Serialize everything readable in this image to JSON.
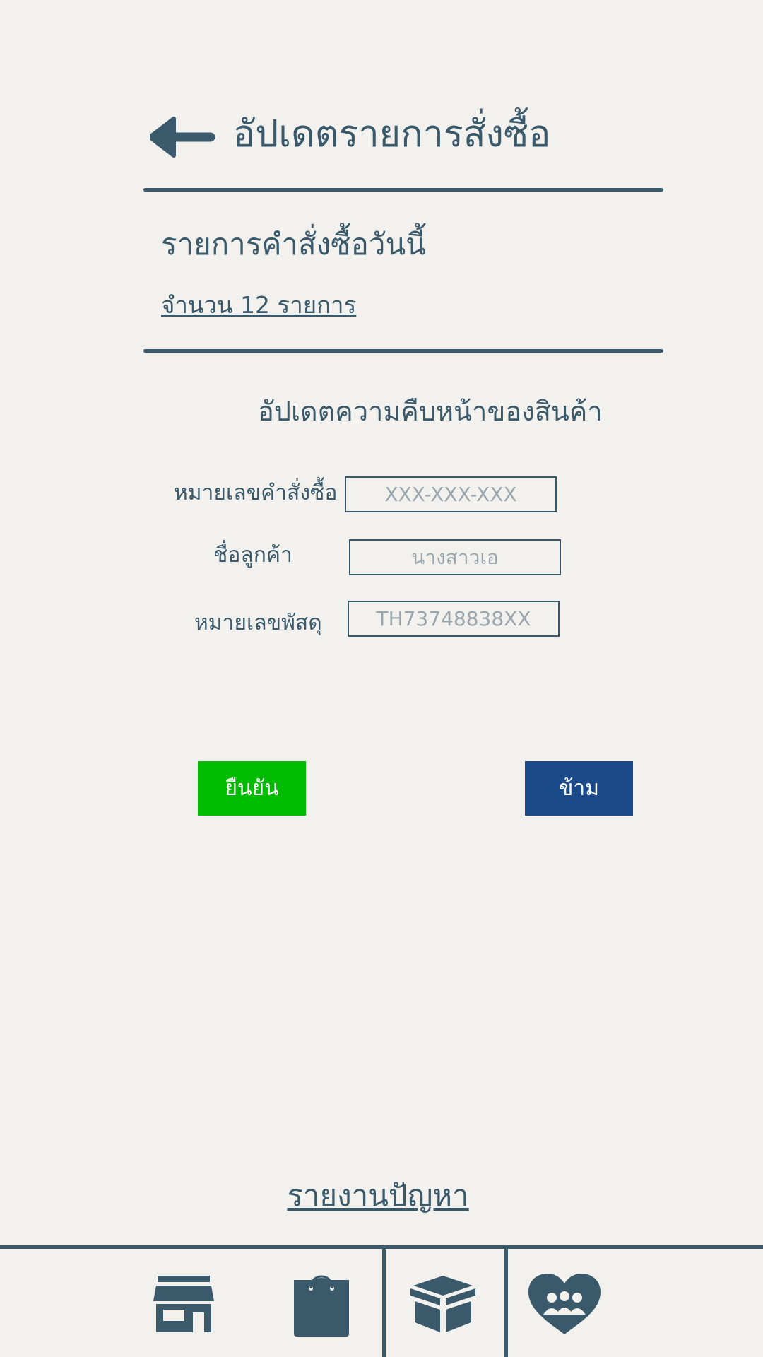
{
  "header": {
    "title": "อัปเดตรายการสั่งซื้อ",
    "back_icon": "arrow-left-icon"
  },
  "summary": {
    "title": "รายการคำสั่งซื้อวันนี้",
    "count_link": "จำนวน 12 รายการ"
  },
  "form": {
    "title": "อัปเดตความคืบหน้าของสินค้า",
    "fields": [
      {
        "label": "หมายเลขคำสั่งซื้อ",
        "placeholder": "XXX-XXX-XXX"
      },
      {
        "label": "ชื่อลูกค้า",
        "placeholder": "นางสาวเอ"
      },
      {
        "label": "หมายเลขพัสดุ",
        "placeholder": "TH73748838XX"
      }
    ],
    "confirm_label": "ยืนยัน",
    "skip_label": "ข้าม"
  },
  "report_link": "รายงานปัญหา",
  "bottom_nav": {
    "items": [
      {
        "icon": "store-icon"
      },
      {
        "icon": "shopping-bag-icon"
      },
      {
        "icon": "package-box-icon"
      },
      {
        "icon": "community-heart-icon"
      }
    ]
  },
  "colors": {
    "primary": "#3a5a6c",
    "background": "#f2f1ed",
    "confirm_button": "#00bb00",
    "skip_button": "#1a4a8a",
    "placeholder": "#9aa7ae"
  }
}
